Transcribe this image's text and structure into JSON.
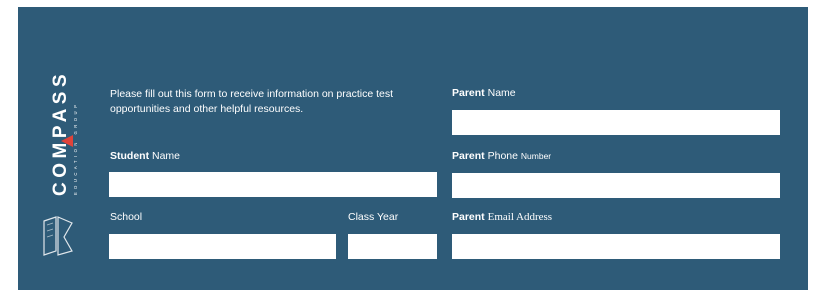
{
  "logo": {
    "wordmark": "COMPASS",
    "tagline": "EDUCATION GROUP",
    "icon": "open-book-icon",
    "accent_color": "#e0433a"
  },
  "form": {
    "intro": "Please fill out this form to receive information on practice test opportunities and other helpful resources.",
    "student_name": {
      "bold": "Student",
      "rest": "Name",
      "value": ""
    },
    "school": {
      "label": "School",
      "value": ""
    },
    "class_year": {
      "label": "Class Year",
      "value": ""
    },
    "parent_name": {
      "bold": "Parent",
      "rest": "Name",
      "value": ""
    },
    "parent_phone": {
      "bold": "Parent",
      "rest": "Phone",
      "rest_small": "Number",
      "value": ""
    },
    "parent_email": {
      "bold": "Parent",
      "rest": "Email Address",
      "value": ""
    }
  },
  "colors": {
    "panel_bg": "#2e5b78",
    "field_bg": "#ffffff",
    "text": "#ffffff"
  }
}
